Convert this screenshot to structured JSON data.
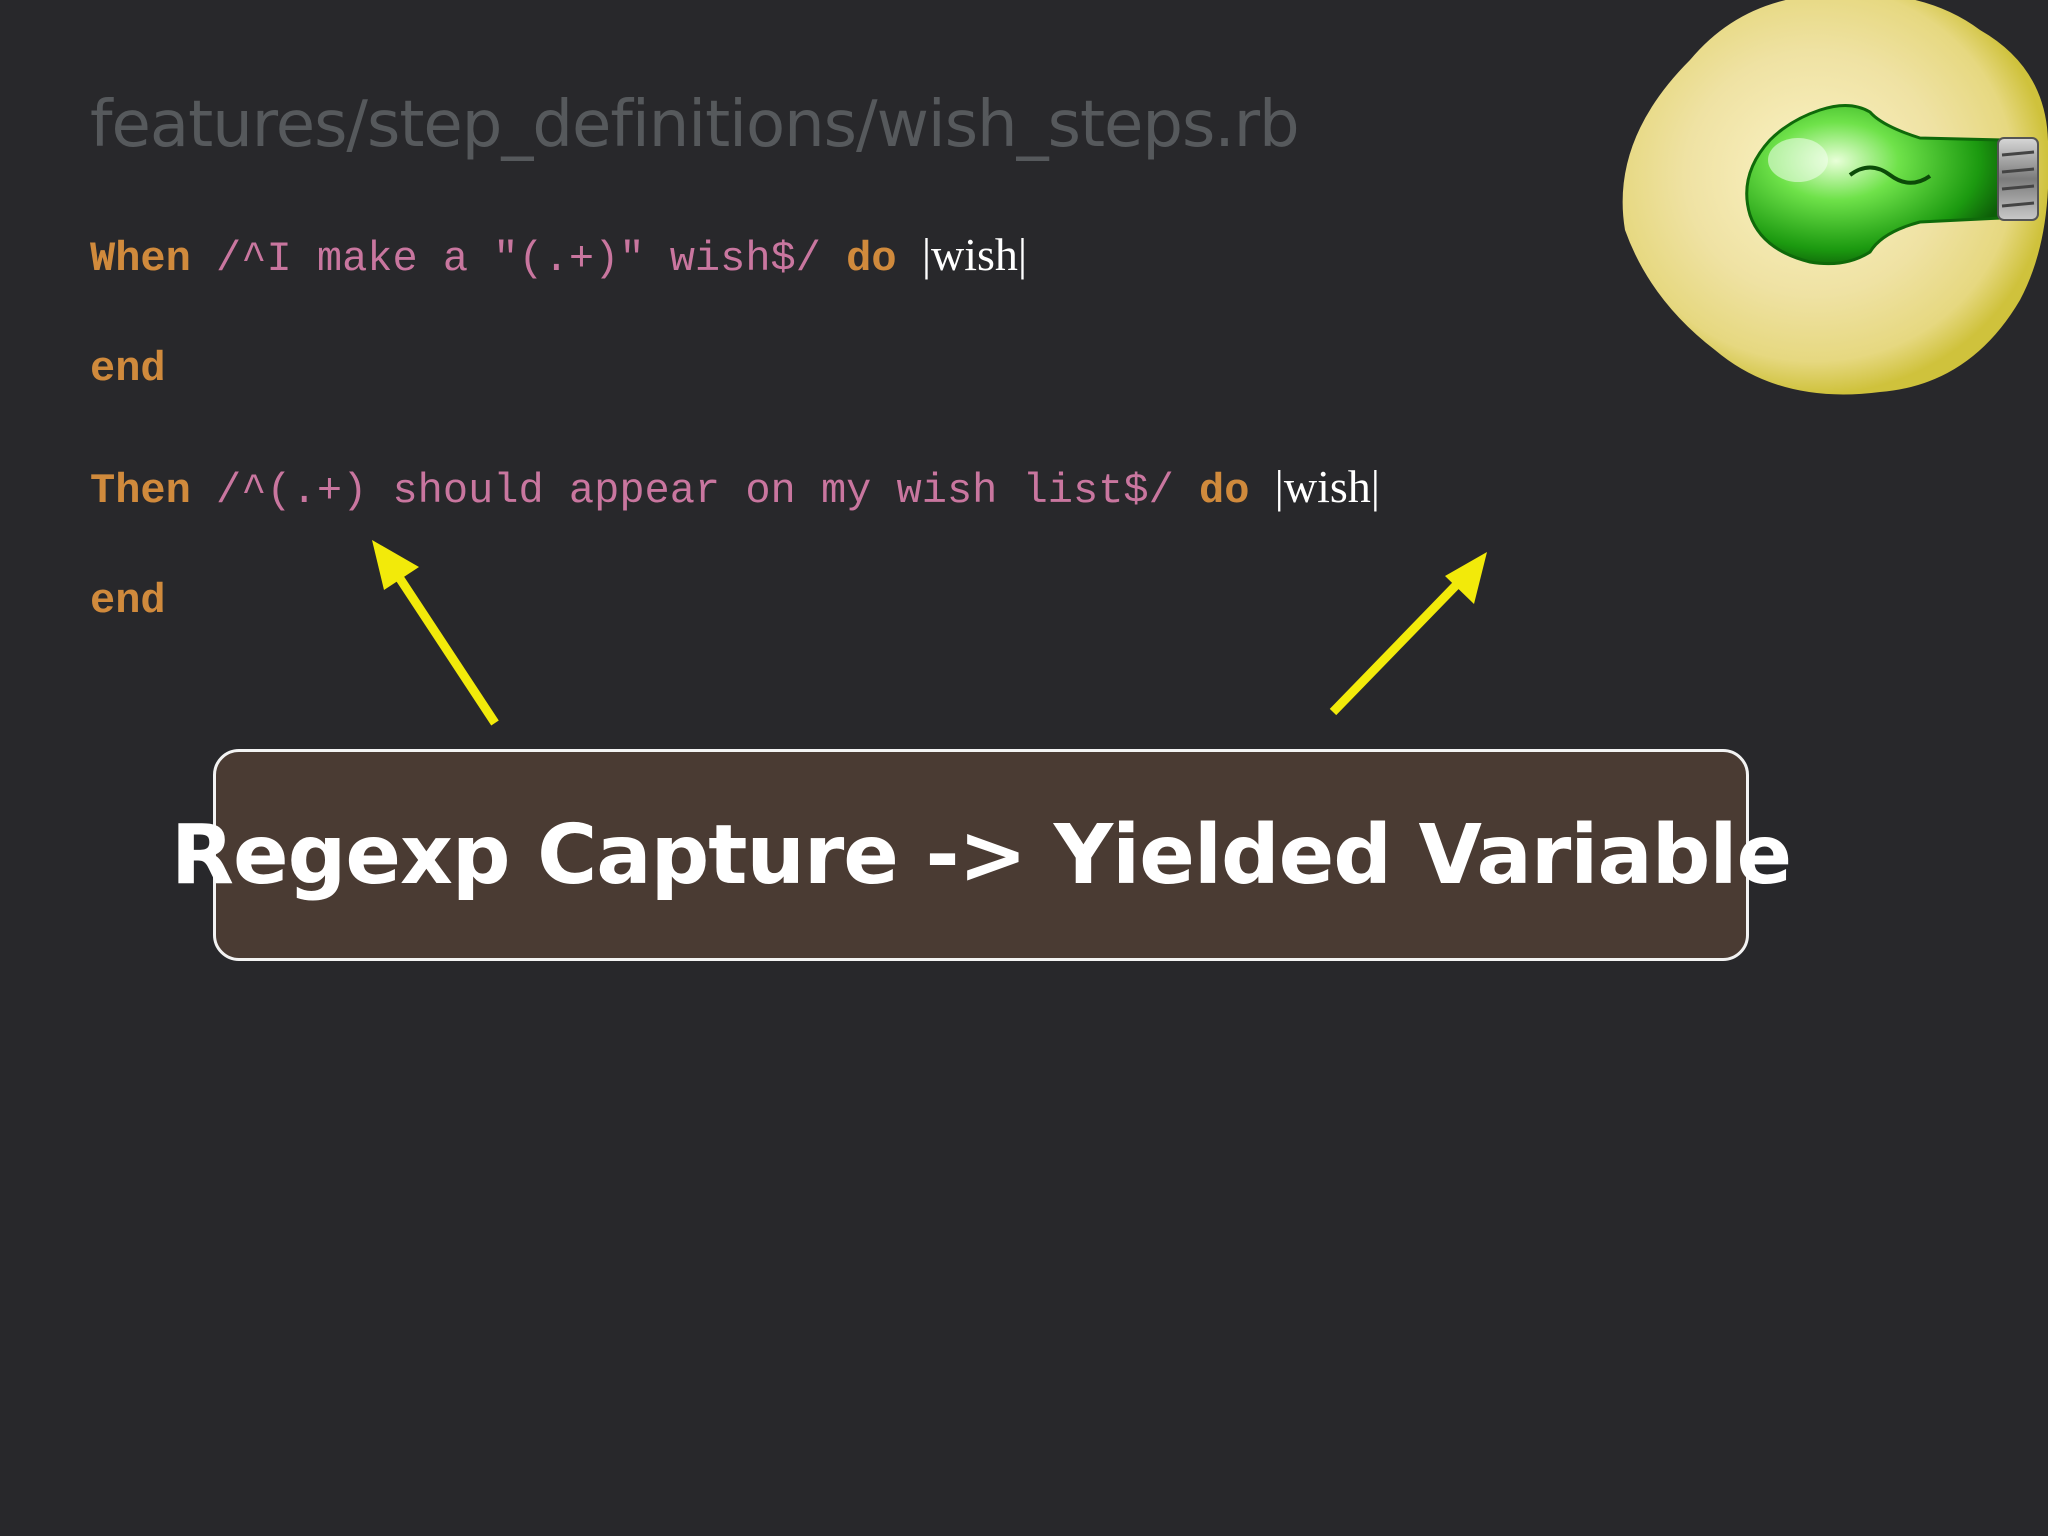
{
  "file_path": "features/step_definitions/wish_steps.rb",
  "code": {
    "line1": {
      "keyword": "When",
      "regex": "/^I make a \"(.+)\" wish$/",
      "do": "do",
      "block_arg": "|wish|"
    },
    "line2": {
      "keyword": "end"
    },
    "line3": {
      "keyword": "Then",
      "regex": "/^(.+) should appear on my wish list$/",
      "do": "do",
      "block_arg": "|wish|"
    },
    "line4": {
      "keyword": "end"
    }
  },
  "callout": {
    "text": "Regexp Capture -> Yielded Variable"
  },
  "colors": {
    "background": "#28282b",
    "keyword": "#d08a3c",
    "regex": "#c9769f",
    "arrow": "#f2ea0a",
    "callout_fill": "#4a3b33"
  },
  "icons": {
    "bulb": "green-lightbulb-icon",
    "arrow": "arrow-icon"
  }
}
